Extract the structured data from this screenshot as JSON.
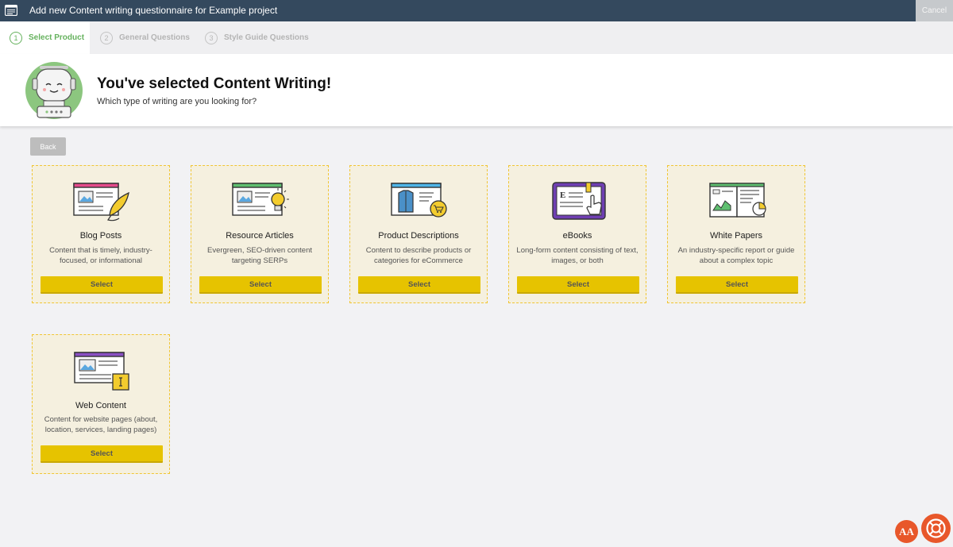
{
  "topbar": {
    "title": "Add new Content writing questionnaire for Example project",
    "cancel_label": "Cancel"
  },
  "steps": [
    {
      "num": "1",
      "label": "Select Product",
      "state": "active"
    },
    {
      "num": "2",
      "label": "General Questions",
      "state": "inactive"
    },
    {
      "num": "3",
      "label": "Style Guide Questions",
      "state": "inactive"
    }
  ],
  "header": {
    "title": "You've selected Content Writing!",
    "subtitle": "Which type of writing are you looking for?"
  },
  "back_label": "Back",
  "cards": [
    {
      "title": "Blog Posts",
      "desc": "Content that is timely, industry-focused, or informational",
      "select": "Select",
      "icon": "blog-post-icon"
    },
    {
      "title": "Resource Articles",
      "desc": "Evergreen, SEO-driven content targeting SERPs",
      "select": "Select",
      "icon": "resource-article-icon"
    },
    {
      "title": "Product Descriptions",
      "desc": "Content to describe products or categories for eCommerce",
      "select": "Select",
      "icon": "product-description-icon"
    },
    {
      "title": "eBooks",
      "desc": "Long-form content consisting of text, images, or both",
      "select": "Select",
      "icon": "ebook-icon"
    },
    {
      "title": "White Papers",
      "desc": "An industry-specific report or guide about a complex topic",
      "select": "Select",
      "icon": "white-paper-icon"
    },
    {
      "title": "Web Content",
      "desc": "Content for website pages (about, location, services, landing pages)",
      "select": "Select",
      "icon": "web-content-icon"
    }
  ],
  "fab": {
    "font_label": "AA"
  },
  "colors": {
    "topbar": "#34495e",
    "active_step": "#66b25e",
    "card_bg": "#f5f0df",
    "card_border": "#f0c534",
    "select_button": "#e6c300",
    "fab": "#e8572a"
  }
}
